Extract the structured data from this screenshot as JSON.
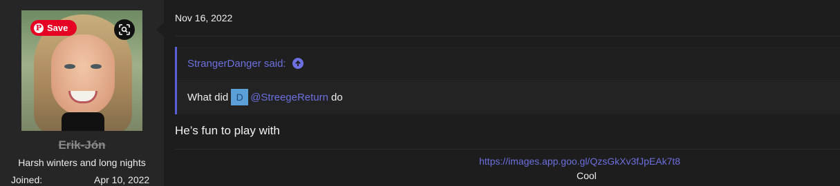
{
  "user": {
    "avatar_pin_label": "Save",
    "avatar_pin_logo": "P",
    "name": "Erik-Jón",
    "title": "Harsh winters and long nights",
    "joined_label": "Joined:",
    "joined_value": "Apr 10, 2022"
  },
  "post": {
    "date": "Nov 16, 2022",
    "quote": {
      "author": "StrangerDanger said:",
      "body_prefix": "What did",
      "mention_avatar_letter": "D",
      "mention": "@StreegeReturn",
      "body_suffix": "do"
    },
    "body": "He’s fun to play with",
    "link": "https://images.app.goo.gl/QzsGkXv3fJpEAk7t8",
    "caption": "Cool"
  },
  "colors": {
    "accent": "#6c70e0",
    "pinterest": "#e60023",
    "background": "#1d1d1d",
    "sidebar": "#262626"
  },
  "icons": {
    "pin": "pinterest-icon",
    "lens": "visual-search-icon",
    "quote_up": "arrow-up-circle-icon"
  }
}
